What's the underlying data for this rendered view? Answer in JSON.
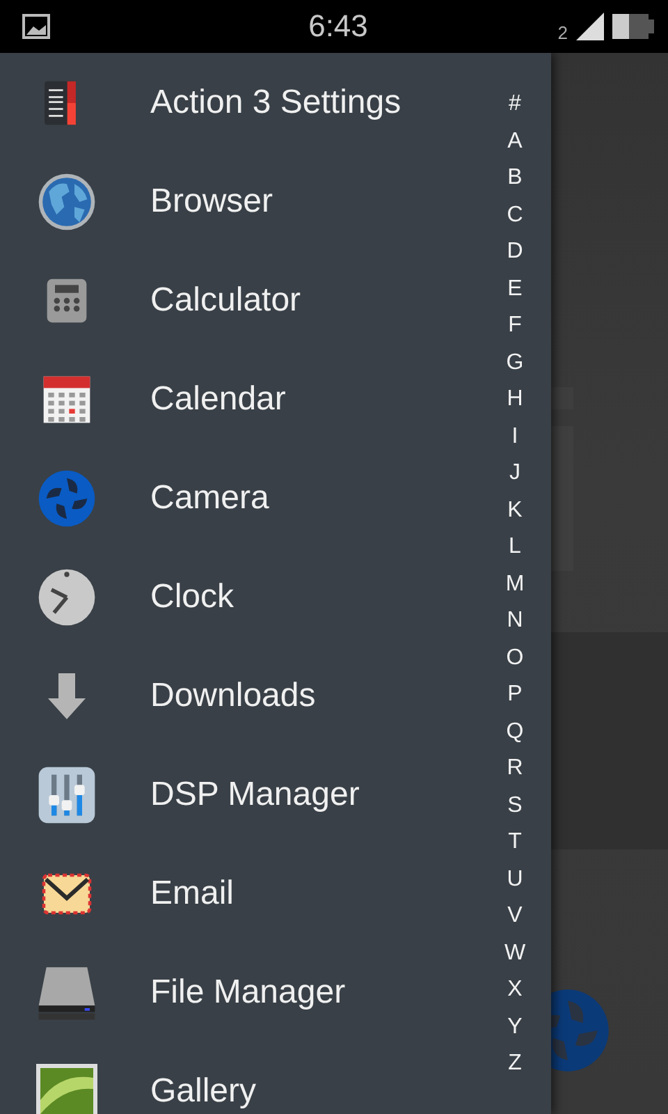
{
  "status_bar": {
    "time": "6:43",
    "sim_number": "2"
  },
  "apps": [
    {
      "label": "Action 3 Settings"
    },
    {
      "label": "Browser"
    },
    {
      "label": "Calculator"
    },
    {
      "label": "Calendar"
    },
    {
      "label": "Camera"
    },
    {
      "label": "Clock"
    },
    {
      "label": "Downloads"
    },
    {
      "label": "DSP Manager"
    },
    {
      "label": "Email"
    },
    {
      "label": "File Manager"
    },
    {
      "label": "Gallery"
    }
  ],
  "index": [
    "#",
    "A",
    "B",
    "C",
    "D",
    "E",
    "F",
    "G",
    "H",
    "I",
    "J",
    "K",
    "L",
    "M",
    "N",
    "O",
    "P",
    "Q",
    "R",
    "S",
    "T",
    "U",
    "V",
    "W",
    "X",
    "Y",
    "Z"
  ]
}
